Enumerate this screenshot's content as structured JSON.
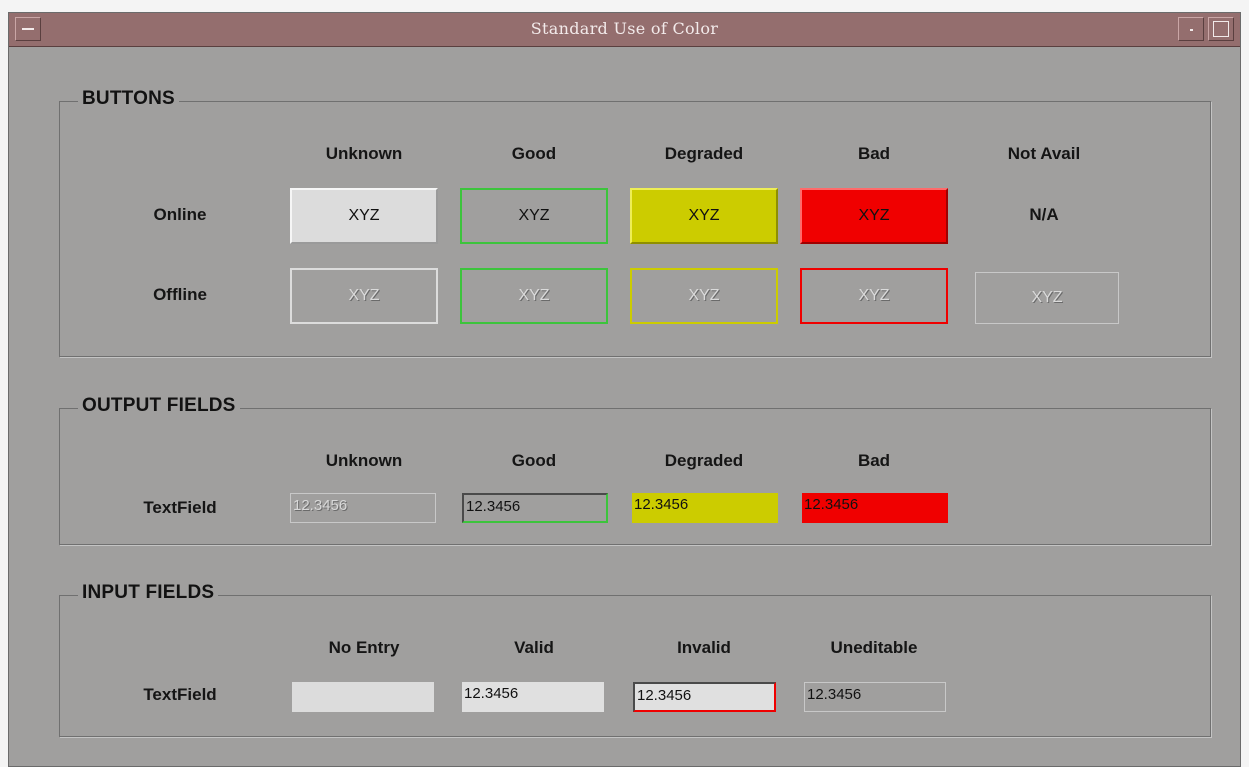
{
  "window": {
    "title": "Standard Use of Color"
  },
  "buttons_group": {
    "title": "BUTTONS",
    "columns": [
      "Unknown",
      "Good",
      "Degraded",
      "Bad",
      "Not Avail"
    ],
    "rows": {
      "online": {
        "label": "Online",
        "button_text": "XYZ",
        "not_avail_text": "N/A"
      },
      "offline": {
        "label": "Offline",
        "button_text": "XYZ"
      }
    }
  },
  "output_group": {
    "title": "OUTPUT FIELDS",
    "columns": [
      "Unknown",
      "Good",
      "Degraded",
      "Bad"
    ],
    "row_label": "TextField",
    "values": [
      "12.3456",
      "12.3456",
      "12.3456",
      "12.3456"
    ]
  },
  "input_group": {
    "title": "INPUT FIELDS",
    "columns": [
      "No Entry",
      "Valid",
      "Invalid",
      "Uneditable"
    ],
    "row_label": "TextField",
    "values": [
      "",
      "12.3456",
      "12.3456",
      "12.3456"
    ]
  },
  "colors": {
    "window_bg": "#a09f9e",
    "titlebar": "#946e6e",
    "unknown": "#dcdcdc",
    "good": "#3cc43c",
    "degraded": "#cccc00",
    "bad": "#f00000"
  }
}
